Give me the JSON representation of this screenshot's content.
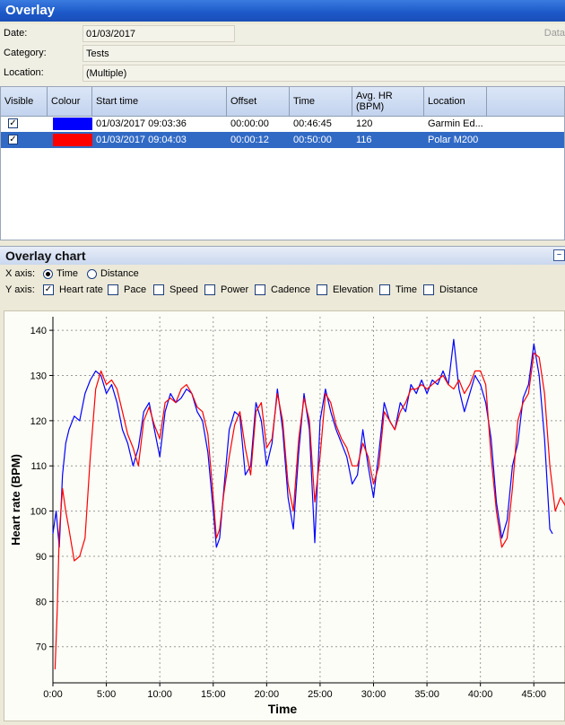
{
  "panel": {
    "title": "Overlay"
  },
  "fields": [
    {
      "label": "Date:",
      "value": "01/03/2017"
    },
    {
      "label": "Category:",
      "value": "Tests"
    },
    {
      "label": "Location:",
      "value": "(Multiple)"
    }
  ],
  "side_label": "Data",
  "grid": {
    "columns": [
      "Visible",
      "Colour",
      "Start time",
      "Offset",
      "Time",
      "Avg. HR (BPM)",
      "Location"
    ],
    "rows": [
      {
        "visible": true,
        "colour": "#0000ff",
        "start": "01/03/2017 09:03:36",
        "offset": "00:00:00",
        "time": "00:46:45",
        "avg_hr": "120",
        "location": "Garmin Ed...",
        "selected": false
      },
      {
        "visible": true,
        "colour": "#ff0000",
        "start": "01/03/2017 09:04:03",
        "offset": "00:00:12",
        "time": "00:50:00",
        "avg_hr": "116",
        "location": "Polar M200",
        "selected": true
      }
    ]
  },
  "chart_panel": {
    "title": "Overlay chart",
    "x_axis_label": "X axis:",
    "x_options": [
      {
        "label": "Time",
        "selected": true
      },
      {
        "label": "Distance",
        "selected": false
      }
    ],
    "y_axis_label": "Y axis:",
    "y_options": [
      {
        "label": "Heart rate",
        "checked": true
      },
      {
        "label": "Pace",
        "checked": false
      },
      {
        "label": "Speed",
        "checked": false
      },
      {
        "label": "Power",
        "checked": false
      },
      {
        "label": "Cadence",
        "checked": false
      },
      {
        "label": "Elevation",
        "checked": false
      },
      {
        "label": "Time",
        "checked": false
      },
      {
        "label": "Distance",
        "checked": false
      }
    ]
  },
  "chart_data": {
    "type": "line",
    "xlabel": "Time",
    "ylabel": "Heart rate (BPM)",
    "xlim": [
      0,
      48
    ],
    "ylim": [
      62,
      143
    ],
    "grid": true,
    "x_ticks": [
      "0:00",
      "5:00",
      "10:00",
      "15:00",
      "20:00",
      "25:00",
      "30:00",
      "35:00",
      "40:00",
      "45:00"
    ],
    "y_ticks": [
      70,
      80,
      90,
      100,
      110,
      120,
      130,
      140
    ],
    "series": [
      {
        "color": "#0000ff",
        "x": [
          0,
          0.3,
          0.6,
          0.9,
          1.2,
          1.5,
          2,
          2.5,
          3,
          3.5,
          4,
          4.5,
          5,
          5.5,
          6,
          6.5,
          7,
          7.5,
          8,
          8.5,
          9,
          9.5,
          10,
          10.5,
          11,
          11.5,
          12,
          12.5,
          13,
          13.5,
          14,
          14.5,
          15,
          15.3,
          15.6,
          16,
          16.5,
          17,
          17.5,
          18,
          18.5,
          19,
          19.5,
          20,
          20.5,
          21,
          21.5,
          22,
          22.5,
          23,
          23.5,
          24,
          24.5,
          25,
          25.5,
          26,
          26.5,
          27,
          27.5,
          28,
          28.5,
          29,
          29.5,
          30,
          30.5,
          31,
          31.5,
          32,
          32.5,
          33,
          33.5,
          34,
          34.5,
          35,
          35.5,
          36,
          36.5,
          37,
          37.5,
          38,
          38.5,
          39,
          39.5,
          40,
          40.5,
          41,
          41.5,
          42,
          42.5,
          43,
          43.5,
          44,
          44.5,
          45,
          45.5,
          46,
          46.5,
          46.75
        ],
        "y": [
          95,
          100,
          92,
          108,
          115,
          118,
          121,
          120,
          126,
          129,
          131,
          130,
          126,
          128,
          124,
          118,
          115,
          110,
          114,
          122,
          124,
          118,
          112,
          122,
          126,
          124,
          125,
          127,
          126,
          122,
          120,
          113,
          100,
          92,
          94,
          105,
          118,
          122,
          121,
          108,
          110,
          124,
          120,
          110,
          115,
          127,
          118,
          103,
          96,
          113,
          126,
          118,
          93,
          120,
          127,
          122,
          118,
          115,
          112,
          106,
          108,
          118,
          110,
          103,
          113,
          124,
          120,
          118,
          124,
          122,
          128,
          126,
          129,
          126,
          129,
          128,
          131,
          128,
          138,
          127,
          122,
          126,
          130,
          128,
          124,
          116,
          102,
          94,
          98,
          110,
          115,
          125,
          128,
          137,
          130,
          116,
          96,
          95
        ]
      },
      {
        "color": "#ff0000",
        "x": [
          0.2,
          0.4,
          0.6,
          0.9,
          1.2,
          1.5,
          2,
          2.5,
          3,
          3.5,
          4,
          4.5,
          5,
          5.5,
          6,
          6.5,
          7,
          7.5,
          8,
          8.5,
          9,
          9.5,
          10,
          10.5,
          11,
          11.5,
          12,
          12.5,
          13,
          13.5,
          14,
          14.5,
          15,
          15.3,
          15.6,
          16,
          16.5,
          17,
          17.5,
          18,
          18.5,
          19,
          19.5,
          20,
          20.5,
          21,
          21.5,
          22,
          22.5,
          23,
          23.5,
          24,
          24.5,
          25,
          25.5,
          26,
          26.5,
          27,
          27.5,
          28,
          28.5,
          29,
          29.5,
          30,
          30.5,
          31,
          31.5,
          32,
          32.5,
          33,
          33.5,
          34,
          34.5,
          35,
          35.5,
          36,
          36.5,
          37,
          37.5,
          38,
          38.5,
          39,
          39.5,
          40,
          40.5,
          41,
          41.5,
          42,
          42.5,
          43,
          43.5,
          44,
          44.5,
          45,
          45.5,
          46,
          46.5,
          47,
          47.5,
          48
        ],
        "y": [
          65,
          78,
          95,
          105,
          100,
          96,
          89,
          90,
          94,
          112,
          127,
          131,
          128,
          129,
          127,
          122,
          117,
          114,
          110,
          120,
          123,
          119,
          116,
          124,
          125,
          124,
          127,
          128,
          126,
          123,
          122,
          117,
          103,
          94,
          96,
          104,
          112,
          119,
          122,
          114,
          108,
          122,
          124,
          114,
          116,
          126,
          120,
          106,
          100,
          116,
          125,
          120,
          102,
          112,
          126,
          124,
          119,
          116,
          114,
          110,
          110,
          115,
          112,
          106,
          110,
          122,
          120,
          118,
          122,
          124,
          127,
          127,
          128,
          127,
          128,
          129,
          130,
          128,
          127,
          129,
          126,
          128,
          131,
          131,
          128,
          112,
          100,
          92,
          94,
          105,
          120,
          124,
          126,
          135,
          134,
          126,
          110,
          100,
          103,
          101
        ]
      }
    ]
  }
}
